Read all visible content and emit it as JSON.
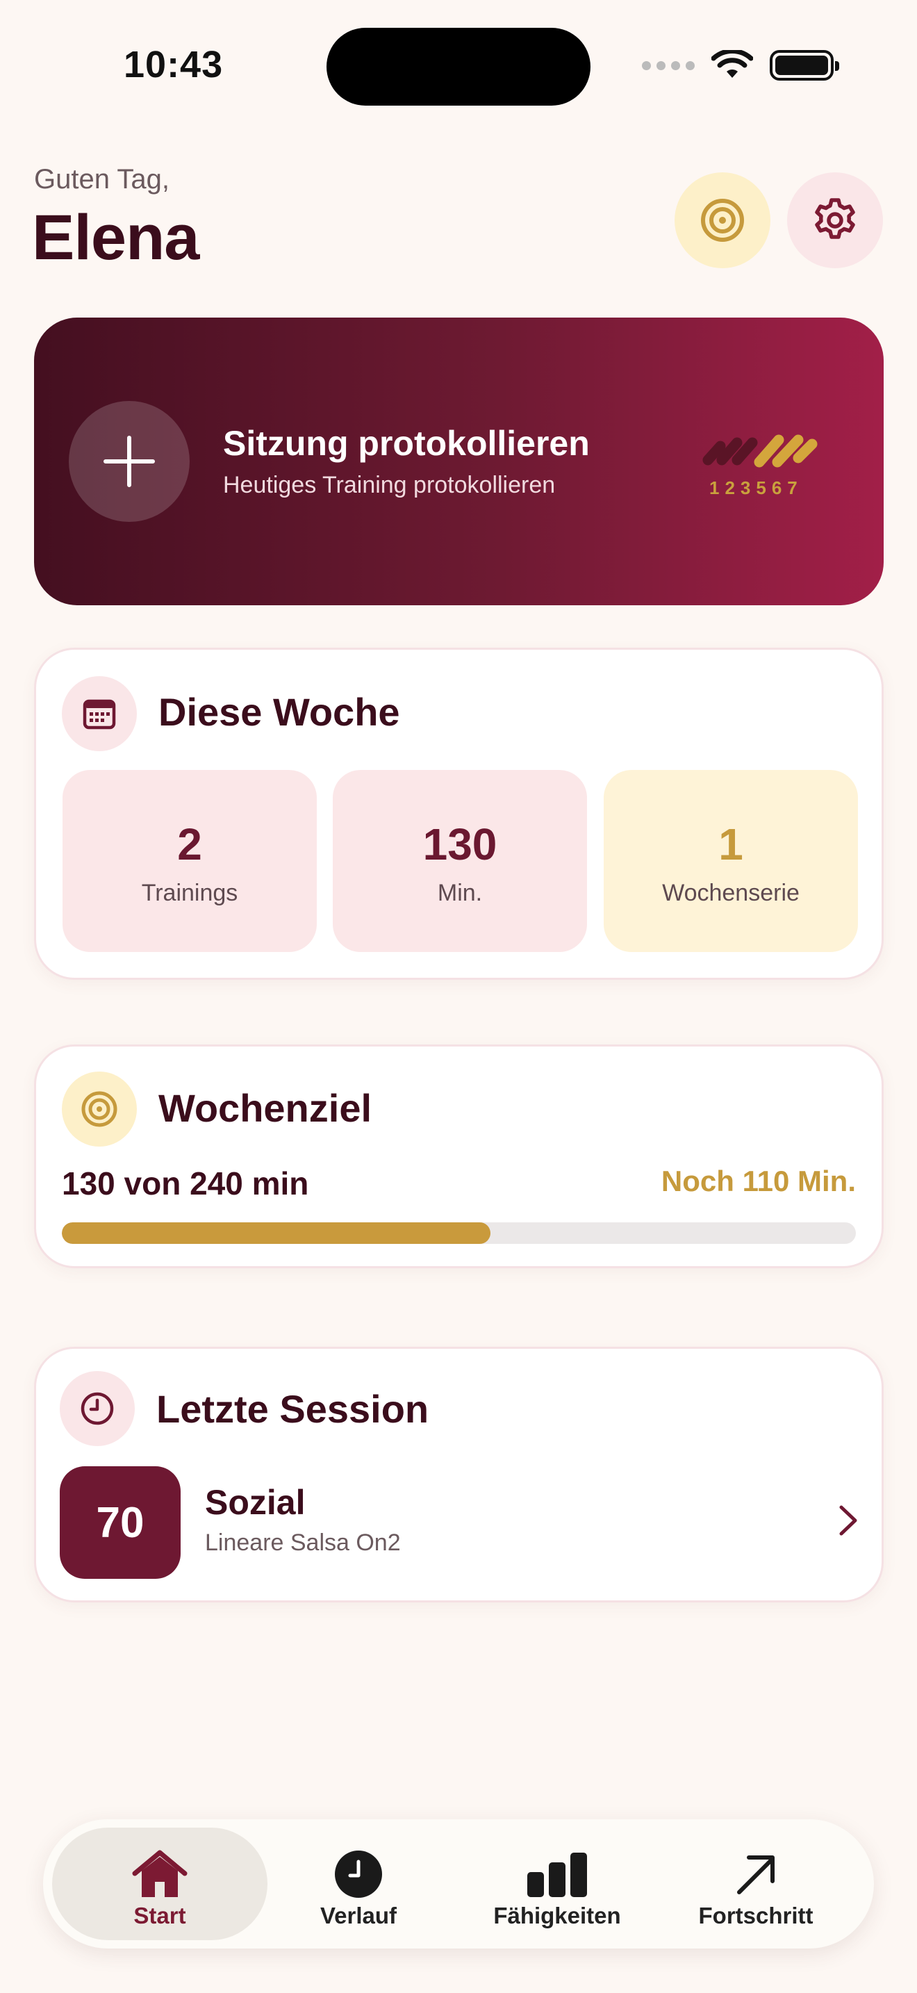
{
  "status_bar": {
    "time": "10:43"
  },
  "header": {
    "greeting": "Guten Tag,",
    "name": "Elena"
  },
  "log_session": {
    "title": "Sitzung protokollieren",
    "subtitle": "Heutiges Training protokollieren",
    "graphic_numbers": "123567"
  },
  "this_week": {
    "title": "Diese Woche",
    "stats": [
      {
        "value": "2",
        "label": "Trainings"
      },
      {
        "value": "130",
        "label": "Min."
      },
      {
        "value": "1",
        "label": "Wochenserie"
      }
    ]
  },
  "weekly_goal": {
    "title": "Wochenziel",
    "progress_text": "130 von 240 min",
    "remaining_text": "Noch 110 Min.",
    "progress_fraction": 0.54
  },
  "last_session": {
    "title": "Letzte Session",
    "score": "70",
    "session_title": "Sozial",
    "session_subtitle": "Lineare Salsa On2"
  },
  "tabs": [
    {
      "label": "Start",
      "icon": "house-icon",
      "active": true
    },
    {
      "label": "Verlauf",
      "icon": "clock-icon",
      "active": false
    },
    {
      "label": "Fähigkeiten",
      "icon": "bar-chart-icon",
      "active": false
    },
    {
      "label": "Fortschritt",
      "icon": "arrow-up-right-icon",
      "active": false
    }
  ],
  "colors": {
    "background": "#fdf7f3",
    "brand_dark": "#3b0d1c",
    "brand_wine": "#6e1832",
    "accent_gold": "#c99a3c",
    "tile_pink": "#fbe7e8",
    "tile_yellow": "#fef3d7"
  }
}
